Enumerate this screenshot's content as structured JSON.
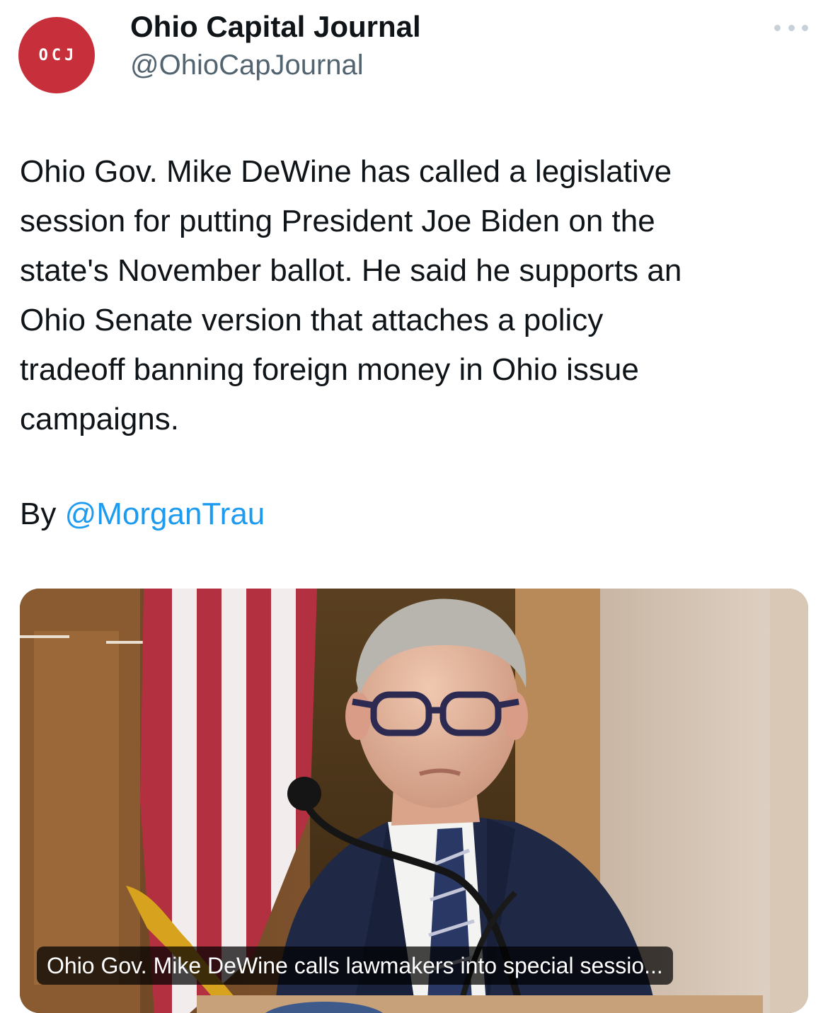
{
  "account": {
    "avatar_text": "OCJ",
    "avatar_color": "#c7303a",
    "display_name": "Ohio Capital Journal",
    "handle": "@OhioCapJournal"
  },
  "more_icon": "more-horizontal-icon",
  "tweet": {
    "text": "Ohio Gov. Mike DeWine has called a legislative\nsession for putting President Joe Biden on the\nstate's November ballot. He said he supports an\nOhio Senate version that attaches a policy\ntradeoff banning foreign money in Ohio issue\ncampaigns.",
    "byline_prefix": "By ",
    "byline_mention": "@MorganTrau",
    "mention_color": "#1d9bf0"
  },
  "media": {
    "caption": "Ohio Gov. Mike DeWine calls lawmakers into special sessio..."
  }
}
